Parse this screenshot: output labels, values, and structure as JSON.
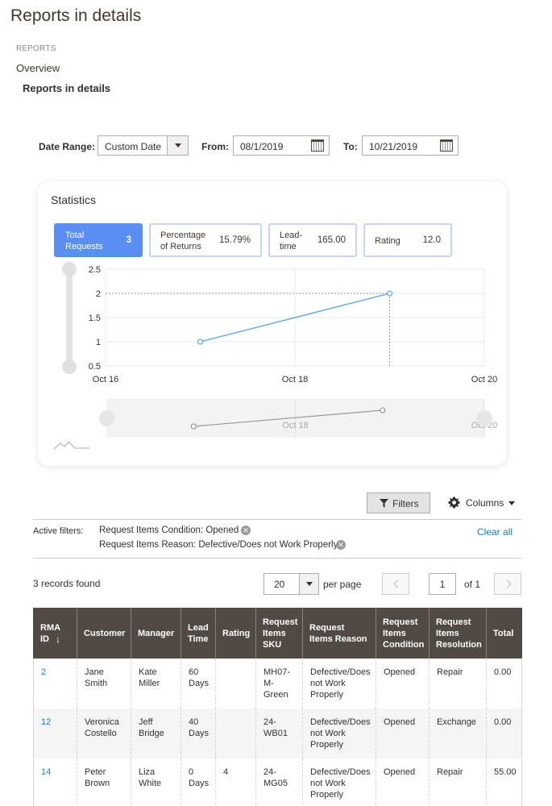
{
  "page": {
    "title": "Reports in details",
    "breadcrumb_section": "REPORTS",
    "nav_overview": "Overview",
    "nav_current": "Reports in details"
  },
  "date_filter": {
    "range_label": "Date Range:",
    "range_value": "Custom Date",
    "from_label": "From:",
    "from_value": "08/1/2019",
    "to_label": "To:",
    "to_value": "10/21/2019"
  },
  "statistics": {
    "title": "Statistics",
    "metrics": [
      {
        "label_line1": "Total",
        "label_line2": "Requests",
        "value": "3"
      },
      {
        "label_line1": "Percentage",
        "label_line2": "of Returns",
        "value": "15.79%"
      },
      {
        "label_line1": "Lead-",
        "label_line2": "time",
        "value": "165.00"
      },
      {
        "label_line1": "Rating",
        "label_line2": "",
        "value": "12.0"
      }
    ]
  },
  "chart_data": {
    "type": "line",
    "x": [
      "Oct 17",
      "Oct 19"
    ],
    "series": [
      {
        "values": [
          1,
          2
        ]
      }
    ],
    "x_ticks": [
      "Oct 16",
      "Oct 18",
      "Oct 20"
    ],
    "y_ticks": [
      "2.5",
      "2",
      "1.5",
      "1",
      "0.5"
    ],
    "ylim": [
      0.5,
      2.5
    ],
    "navigator_ticks": [
      "Oct 18",
      "Oct 20"
    ],
    "line_color": "#6aaee0",
    "grid": true
  },
  "toolbar": {
    "filters_label": "Filters",
    "columns_label": "Columns"
  },
  "active_filters": {
    "label": "Active filters:",
    "items": [
      "Request Items Condition: Opened",
      "Request Items Reason: Defective/Does not Work Properly"
    ],
    "clear_all": "Clear all"
  },
  "pagination": {
    "records_found": "3 records found",
    "per_page_value": "20",
    "per_page_label": "per page",
    "current_page": "1",
    "of_pages": "of 1"
  },
  "table": {
    "headers": [
      "RMA ID",
      "Customer",
      "Manager",
      "Lead Time",
      "Rating",
      "Request Items SKU",
      "Request Items Reason",
      "Request Items Condition",
      "Request Items Resolution",
      "Total"
    ],
    "sort_arrow": "↓",
    "rows": [
      [
        "2",
        "Jane Smith",
        "Kate Miller",
        "60 Days",
        "",
        "MH07-M-Green",
        "Defective/Does not Work Properly",
        "Opened",
        "Repair",
        "0.00"
      ],
      [
        "12",
        "Veronica Costello",
        "Jeff Bridge",
        "40 Days",
        "",
        "24-WB01",
        "Defective/Does not Work Properly",
        "Opened",
        "Exchange",
        "0.00"
      ],
      [
        "14",
        "Peter Brown",
        "Liza White",
        "0 Days",
        "4",
        "24-MG05",
        "Defective/Does not Work Properly",
        "Opened",
        "Repair",
        "55.00"
      ]
    ]
  }
}
